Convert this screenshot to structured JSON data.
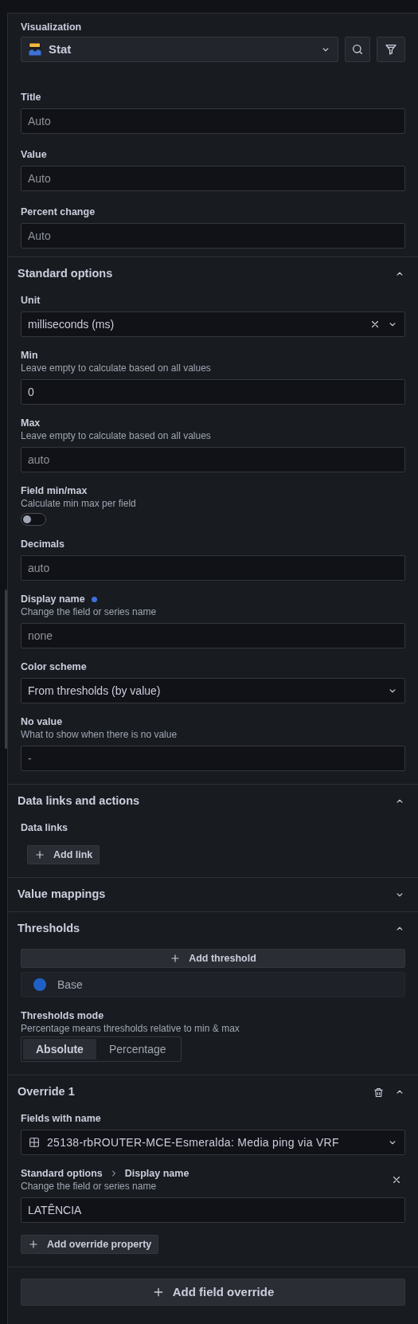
{
  "visualization": {
    "label": "Visualization",
    "value": "Stat"
  },
  "font_size": [
    {
      "label": "Title",
      "placeholder": "Auto"
    },
    {
      "label": "Value",
      "placeholder": "Auto"
    },
    {
      "label": "Percent change",
      "placeholder": "Auto"
    }
  ],
  "sections": [
    {
      "title": "Standard options",
      "expanded": true,
      "items": [
        {
          "kind": "select",
          "label": "Unit",
          "value": "milliseconds (ms)",
          "clearable": true
        },
        {
          "kind": "input",
          "label": "Min",
          "description": "Leave empty to calculate based on all values",
          "value": "0"
        },
        {
          "kind": "input",
          "label": "Max",
          "description": "Leave empty to calculate based on all values",
          "placeholder": "auto"
        },
        {
          "kind": "toggle",
          "label": "Field min/max",
          "description": "Calculate min max per field",
          "on": false
        },
        {
          "kind": "input",
          "label": "Decimals",
          "placeholder": "auto"
        },
        {
          "kind": "input",
          "label": "Display name",
          "description": "Change the field or series name",
          "placeholder": "none",
          "modified": true
        },
        {
          "kind": "select",
          "label": "Color scheme",
          "value": "From thresholds (by value)"
        },
        {
          "kind": "input",
          "label": "No value",
          "description": "What to show when there is no value",
          "placeholder": "-"
        }
      ]
    },
    {
      "title": "Data links and actions",
      "expanded": true,
      "items": [
        {
          "kind": "button",
          "label": "Data links",
          "button": "Add link"
        }
      ]
    },
    {
      "title": "Value mappings",
      "expanded": false
    },
    {
      "title": "Thresholds",
      "expanded": true,
      "items": [
        {
          "kind": "wide_button",
          "button": "Add threshold"
        },
        {
          "kind": "threshold",
          "label": "Base",
          "color": "#1f60c4"
        },
        {
          "kind": "radio",
          "label": "Thresholds mode",
          "description": "Percentage means thresholds relative to min & max",
          "options": [
            {
              "label": "Absolute",
              "selected": true
            },
            {
              "label": "Percentage",
              "selected": false
            }
          ]
        }
      ]
    },
    {
      "title": "Override 1",
      "expanded": true,
      "deletable": true,
      "items": [
        {
          "kind": "field_select",
          "label": "Fields with name",
          "value": "25138-rbROUTER-MCE-Esmeralda: Media ping via VRF"
        },
        {
          "kind": "property",
          "path": [
            "Standard options",
            "Display name"
          ],
          "description": "Change the field or series name",
          "value": "LATÊNCIA"
        },
        {
          "kind": "button",
          "button": "Add override property"
        }
      ]
    }
  ],
  "add_field_override": "Add field override"
}
